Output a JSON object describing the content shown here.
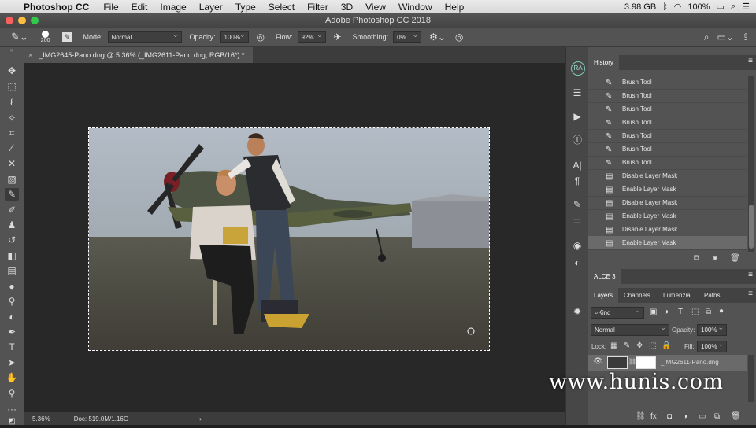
{
  "menubar": {
    "app_name": "Photoshop CC",
    "items": [
      "File",
      "Edit",
      "Image",
      "Layer",
      "Type",
      "Select",
      "Filter",
      "3D",
      "View",
      "Window",
      "Help"
    ],
    "memory": "3.98 GB",
    "battery": "100%"
  },
  "window": {
    "title": "Adobe Photoshop CC 2018"
  },
  "options": {
    "brush_size": "200",
    "mode_label": "Mode:",
    "mode_value": "Normal",
    "opacity_label": "Opacity:",
    "opacity_value": "100%",
    "flow_label": "Flow:",
    "flow_value": "92%",
    "smoothing_label": "Smoothing:",
    "smoothing_value": "0%"
  },
  "document": {
    "tab_title": "_IMG2645-Pano.dng @ 5.36% (_IMG2611-Pano.dng, RGB/16*) *",
    "zoom": "5.36%",
    "doc_info": "Doc: 519.0M/1.16G"
  },
  "dock": {
    "profile_initials": "RA"
  },
  "history": {
    "tab": "History",
    "items": [
      {
        "label": "Brush Tool",
        "icon": "brush-icon"
      },
      {
        "label": "Brush Tool",
        "icon": "brush-icon"
      },
      {
        "label": "Brush Tool",
        "icon": "brush-icon"
      },
      {
        "label": "Brush Tool",
        "icon": "brush-icon"
      },
      {
        "label": "Brush Tool",
        "icon": "brush-icon"
      },
      {
        "label": "Brush Tool",
        "icon": "brush-icon"
      },
      {
        "label": "Brush Tool",
        "icon": "brush-icon"
      },
      {
        "label": "Disable Layer Mask",
        "icon": "document-icon"
      },
      {
        "label": "Enable Layer Mask",
        "icon": "document-icon"
      },
      {
        "label": "Disable Layer Mask",
        "icon": "document-icon"
      },
      {
        "label": "Enable Layer Mask",
        "icon": "document-icon"
      },
      {
        "label": "Disable Layer Mask",
        "icon": "document-icon"
      },
      {
        "label": "Enable Layer Mask",
        "icon": "document-icon"
      }
    ]
  },
  "alce": {
    "tab": "ALCE 3"
  },
  "layers": {
    "tabs": [
      "Layers",
      "Channels",
      "Lumenzia",
      "Paths"
    ],
    "kind": "Kind",
    "blend_mode": "Normal",
    "opacity_label": "Opacity:",
    "opacity_value": "100%",
    "lock_label": "Lock:",
    "fill_label": "Fill:",
    "fill_value": "100%",
    "layer_name": "_IMG2611-Pano.dng"
  },
  "watermark": "www.hunis.com",
  "colors": {
    "accent": "#3a8ee6",
    "panel": "#535353",
    "canvas": "#282828"
  }
}
